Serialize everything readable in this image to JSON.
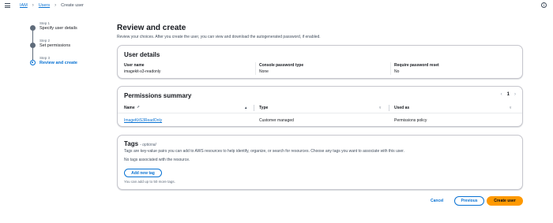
{
  "breadcrumb": {
    "items": [
      "IAM",
      "Users"
    ],
    "current": "Create user"
  },
  "wizard": {
    "steps": [
      {
        "number": "Step 1",
        "name": "Specify user details"
      },
      {
        "number": "Step 2",
        "name": "Set permissions"
      },
      {
        "number": "Step 3",
        "name": "Review and create"
      }
    ],
    "active_step": 3
  },
  "page": {
    "title": "Review and create",
    "subtitle": "Review your choices. After you create the user, you can view and download the autogenerated password, if enabled."
  },
  "user_details": {
    "title": "User details",
    "fields": [
      {
        "label": "User name",
        "value": "imagekit-s3-readonly"
      },
      {
        "label": "Console password type",
        "value": "None"
      },
      {
        "label": "Require password reset",
        "value": "No"
      }
    ]
  },
  "permissions_summary": {
    "title": "Permissions summary",
    "page_number": "1",
    "columns": [
      "Name",
      "Type",
      "Used as"
    ],
    "rows": [
      {
        "name": "ImageKitS3ReadOnly",
        "type": "Customer managed",
        "used_as": "Permissions policy"
      }
    ]
  },
  "tags": {
    "title": "Tags",
    "optional": "- optional",
    "description": "Tags are key-value pairs you can add to AWS resources to help identify, organize, or search for resources. Choose any tags you want to associate with this user.",
    "empty_text": "No tags associated with the resource.",
    "add_button": "Add new tag",
    "hint": "You can add up to 50 more tags."
  },
  "footer": {
    "cancel": "Cancel",
    "previous": "Previous",
    "create": "Create user"
  },
  "colors": {
    "link": "#0972d3",
    "primary_button": "#ff9900"
  }
}
